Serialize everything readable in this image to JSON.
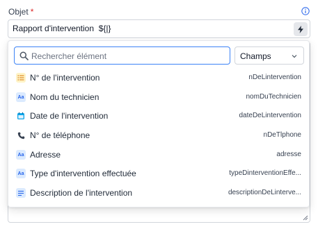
{
  "field": {
    "label": "Objet",
    "required_mark": "*",
    "value": "Rapport d'intervention  ${|}"
  },
  "search": {
    "placeholder": "Rechercher élément",
    "value": ""
  },
  "type_select": {
    "selected": "Champs"
  },
  "items": [
    {
      "icon": "list-icon",
      "label": "N° de l'intervention",
      "key": "nDeLintervention"
    },
    {
      "icon": "text-icon",
      "label": "Nom du technicien",
      "key": "nomDuTechnicien"
    },
    {
      "icon": "calendar-icon",
      "label": "Date de l'intervention",
      "key": "dateDeLintervention"
    },
    {
      "icon": "phone-icon",
      "label": "N° de téléphone",
      "key": "nDeTlphone"
    },
    {
      "icon": "text-icon",
      "label": "Adresse",
      "key": "adresse"
    },
    {
      "icon": "text-icon",
      "label": "Type d'intervention effectuée",
      "key": "typeDinterventionEffe..."
    },
    {
      "icon": "paragraph-icon",
      "label": "Description de l'intervention",
      "key": "descriptionDeLinterve..."
    }
  ],
  "text_icon_glyph": "Aa",
  "colors": {
    "focus_border": "#3b82f6",
    "required": "#dc2626",
    "list_icon_bg": "#fef3c7",
    "text_icon_bg": "#dbeafe",
    "calendar_icon": "#0ea5e9"
  }
}
